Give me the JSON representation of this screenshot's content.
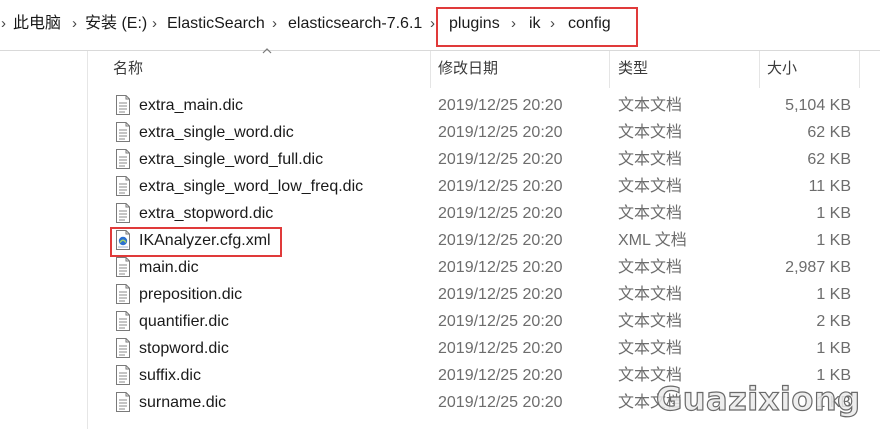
{
  "breadcrumb": {
    "items": [
      "此电脑",
      "安装 (E:)",
      "ElasticSearch",
      "elasticsearch-7.6.1",
      "plugins",
      "ik",
      "config"
    ]
  },
  "columns": {
    "name": "名称",
    "modified": "修改日期",
    "type": "类型",
    "size": "大小"
  },
  "files": [
    {
      "name": "extra_main.dic",
      "modified": "2019/12/25 20:20",
      "type": "文本文档",
      "size": "5,104 KB",
      "icon": "text-file-icon"
    },
    {
      "name": "extra_single_word.dic",
      "modified": "2019/12/25 20:20",
      "type": "文本文档",
      "size": "62 KB",
      "icon": "text-file-icon"
    },
    {
      "name": "extra_single_word_full.dic",
      "modified": "2019/12/25 20:20",
      "type": "文本文档",
      "size": "62 KB",
      "icon": "text-file-icon"
    },
    {
      "name": "extra_single_word_low_freq.dic",
      "modified": "2019/12/25 20:20",
      "type": "文本文档",
      "size": "11 KB",
      "icon": "text-file-icon"
    },
    {
      "name": "extra_stopword.dic",
      "modified": "2019/12/25 20:20",
      "type": "文本文档",
      "size": "1 KB",
      "icon": "text-file-icon"
    },
    {
      "name": "IKAnalyzer.cfg.xml",
      "modified": "2019/12/25 20:20",
      "type": "XML 文档",
      "size": "1 KB",
      "icon": "xml-file-icon"
    },
    {
      "name": "main.dic",
      "modified": "2019/12/25 20:20",
      "type": "文本文档",
      "size": "2,987 KB",
      "icon": "text-file-icon"
    },
    {
      "name": "preposition.dic",
      "modified": "2019/12/25 20:20",
      "type": "文本文档",
      "size": "1 KB",
      "icon": "text-file-icon"
    },
    {
      "name": "quantifier.dic",
      "modified": "2019/12/25 20:20",
      "type": "文本文档",
      "size": "2 KB",
      "icon": "text-file-icon"
    },
    {
      "name": "stopword.dic",
      "modified": "2019/12/25 20:20",
      "type": "文本文档",
      "size": "1 KB",
      "icon": "text-file-icon"
    },
    {
      "name": "suffix.dic",
      "modified": "2019/12/25 20:20",
      "type": "文本文档",
      "size": "1 KB",
      "icon": "text-file-icon"
    },
    {
      "name": "surname.dic",
      "modified": "2019/12/25 20:20",
      "type": "文本文档",
      "size": "1 KB",
      "icon": "text-file-icon"
    }
  ],
  "watermark": "Guazixiong",
  "colors": {
    "highlight": "#e03a3a",
    "secondary_text": "#6d6d6d",
    "xml_icon_accent": "#2b6fd1"
  }
}
